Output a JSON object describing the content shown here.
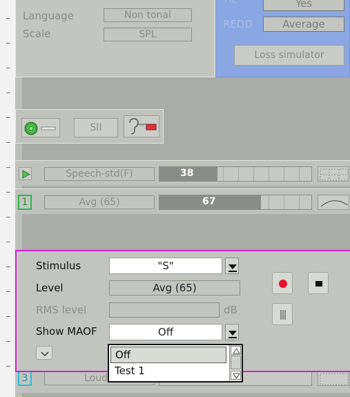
{
  "settings": {
    "language_label": "Language",
    "language_value": "Non tonal",
    "scale_label": "Scale",
    "scale_value": "SPL"
  },
  "hearing_loss": {
    "top_value": "Yes",
    "redd_label": "REDD",
    "redd_value": "Average",
    "loss_simulator_label": "Loss simulator"
  },
  "toolbar": {
    "sii_label": "SII"
  },
  "rows": [
    {
      "name": "Speech-std(F)",
      "level": 38,
      "level_fraction": 0.38
    },
    {
      "index": "1",
      "name": "Avg (65)",
      "level": 67,
      "level_fraction": 0.67
    },
    {
      "index": "3",
      "name": "Loud ("
    }
  ],
  "stimulus": {
    "stimulus_label": "Stimulus",
    "stimulus_value": "\"S\"",
    "level_label": "Level",
    "level_value": "Avg (65)",
    "rms_label": "RMS level",
    "rms_unit": "dB",
    "show_maof_label": "Show MAOF",
    "show_maof_value": "Off",
    "maof_options": [
      "Off",
      "Test 1"
    ]
  },
  "colors": {
    "background": "#a9aca7",
    "hearing_panel": "#8aa7e3",
    "stimulus_border": "#d21fd0",
    "record_red": "#e8112d",
    "row1_index_border": "#2bb84a",
    "row3_index_border": "#2bbfd6"
  }
}
